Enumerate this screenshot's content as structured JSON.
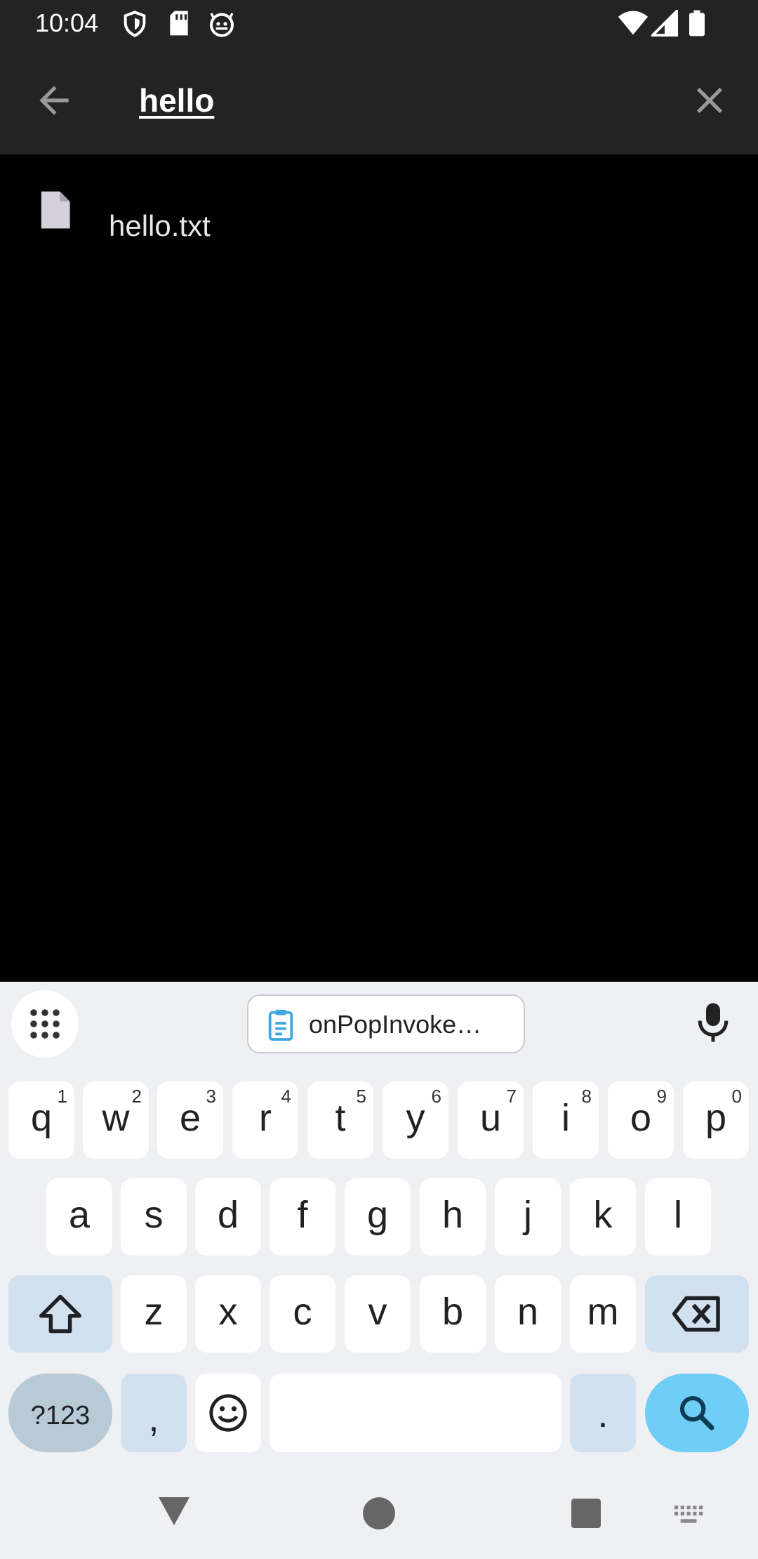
{
  "status_bar": {
    "time": "10:04",
    "icons": [
      "shield-icon",
      "sd-card-icon",
      "android-debug-icon",
      "wifi-icon",
      "signal-icon",
      "battery-icon"
    ]
  },
  "search": {
    "query": "hello",
    "icons": [
      "back-arrow-icon",
      "clear-icon"
    ]
  },
  "results": [
    {
      "name": "hello.txt",
      "icon": "file-icon"
    }
  ],
  "keyboard": {
    "clipboard_suggestion": "onPopInvoke…",
    "row1": [
      {
        "key": "q",
        "sup": "1"
      },
      {
        "key": "w",
        "sup": "2"
      },
      {
        "key": "e",
        "sup": "3"
      },
      {
        "key": "r",
        "sup": "4"
      },
      {
        "key": "t",
        "sup": "5"
      },
      {
        "key": "y",
        "sup": "6"
      },
      {
        "key": "u",
        "sup": "7"
      },
      {
        "key": "i",
        "sup": "8"
      },
      {
        "key": "o",
        "sup": "9"
      },
      {
        "key": "p",
        "sup": "0"
      }
    ],
    "row2": [
      "a",
      "s",
      "d",
      "f",
      "g",
      "h",
      "j",
      "k",
      "l"
    ],
    "row3": [
      "z",
      "x",
      "c",
      "v",
      "b",
      "n",
      "m"
    ],
    "symbols_label": "?123",
    "comma_label": ",",
    "period_label": ".",
    "colors": {
      "background": "#eff0f3",
      "special_key": "#d2e1f0",
      "action_key": "#6fcdf6"
    }
  },
  "nav_bar": {
    "icons": [
      "back-triangle-icon",
      "home-circle-icon",
      "recents-square-icon",
      "keyboard-switch-icon"
    ]
  }
}
